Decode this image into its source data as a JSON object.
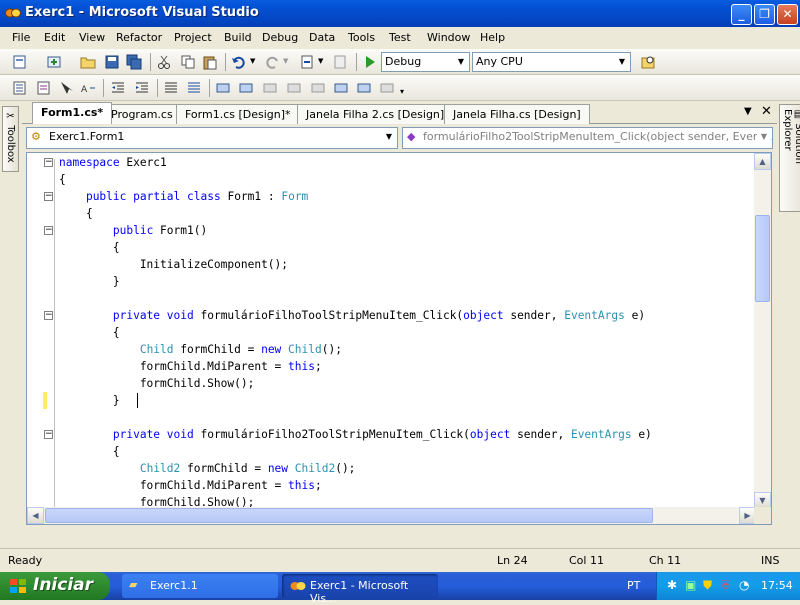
{
  "window": {
    "title": "Exerc1 - Microsoft Visual Studio"
  },
  "menu": [
    "File",
    "Edit",
    "View",
    "Refactor",
    "Project",
    "Build",
    "Debug",
    "Data",
    "Tools",
    "Test",
    "Window",
    "Help"
  ],
  "toolbar": {
    "config": "Debug",
    "platform": "Any CPU"
  },
  "side": {
    "toolbox": "Toolbox",
    "solution_explorer": "Solution Explorer"
  },
  "tabs": [
    {
      "label": "Form1.cs*",
      "active": true
    },
    {
      "label": "Program.cs",
      "active": false
    },
    {
      "label": "Form1.cs [Design]*",
      "active": false
    },
    {
      "label": "Janela Filha 2.cs [Design]",
      "active": false
    },
    {
      "label": "Janela Filha.cs [Design]",
      "active": false
    }
  ],
  "nav": {
    "class_combo": "Exerc1.Form1",
    "member_combo": "formulárioFilho2ToolStripMenuItem_Click(object sender, EventArgs e)"
  },
  "code": [
    "namespace Exerc1",
    "{",
    "    public partial class Form1 : Form",
    "    {",
    "        public Form1()",
    "        {",
    "            InitializeComponent();",
    "        }",
    "",
    "        private void formulárioFilhoToolStripMenuItem_Click(object sender, EventArgs e)",
    "        {",
    "            Child formChild = new Child();",
    "            formChild.MdiParent = this;",
    "            formChild.Show();",
    "        } ",
    "",
    "        private void formulárioFilho2ToolStripMenuItem_Click(object sender, EventArgs e)",
    "        {",
    "            Child2 formChild = new Child2();",
    "            formChild.MdiParent = this;",
    "            formChild.Show();",
    "        }"
  ],
  "status": {
    "ready": "Ready",
    "ln": "Ln 24",
    "col": "Col 11",
    "ch": "Ch 11",
    "mode": "INS"
  },
  "taskbar": {
    "start": "Iniciar",
    "tasks": [
      "Exerc1.1",
      "Exerc1 - Microsoft Vis..."
    ],
    "lang": "PT",
    "clock": "17:54"
  }
}
